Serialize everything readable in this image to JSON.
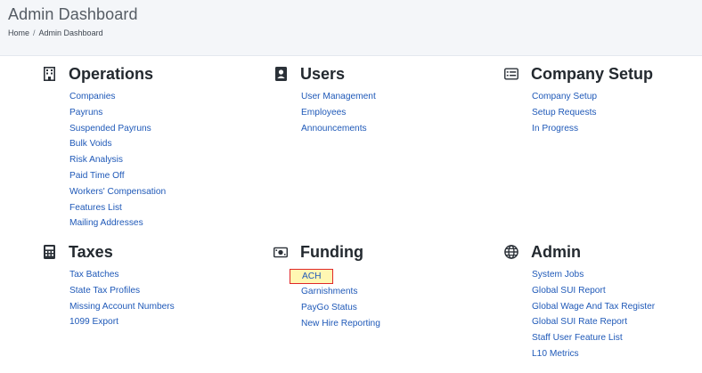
{
  "header": {
    "title": "Admin Dashboard",
    "breadcrumb": {
      "home": "Home",
      "separator": "/",
      "current": "Admin Dashboard"
    }
  },
  "sections": {
    "operations": {
      "title": "Operations",
      "icon": "building-icon",
      "links": [
        "Companies",
        "Payruns",
        "Suspended Payruns",
        "Bulk Voids",
        "Risk Analysis",
        "Paid Time Off",
        "Workers' Compensation",
        "Features List",
        "Mailing Addresses"
      ]
    },
    "users": {
      "title": "Users",
      "icon": "user-badge-icon",
      "links": [
        "User Management",
        "Employees",
        "Announcements"
      ]
    },
    "company_setup": {
      "title": "Company Setup",
      "icon": "list-card-icon",
      "links": [
        "Company Setup",
        "Setup Requests",
        "In Progress"
      ]
    },
    "taxes": {
      "title": "Taxes",
      "icon": "calculator-icon",
      "links": [
        "Tax Batches",
        "State Tax Profiles",
        "Missing Account Numbers",
        "1099 Export"
      ]
    },
    "funding": {
      "title": "Funding",
      "icon": "money-bill-icon",
      "links": [
        "ACH",
        "Garnishments",
        "PayGo Status",
        "New Hire Reporting"
      ]
    },
    "admin": {
      "title": "Admin",
      "icon": "globe-icon",
      "links": [
        "System Jobs",
        "Global SUI Report",
        "Global Wage And Tax Register",
        "Global SUI Rate Report",
        "Staff User Feature List",
        "L10 Metrics"
      ]
    }
  },
  "colors": {
    "link": "#1f59b8",
    "header_bg": "#f4f6f9",
    "highlight_border": "#e02828",
    "highlight_bg": "#fff7b3"
  }
}
